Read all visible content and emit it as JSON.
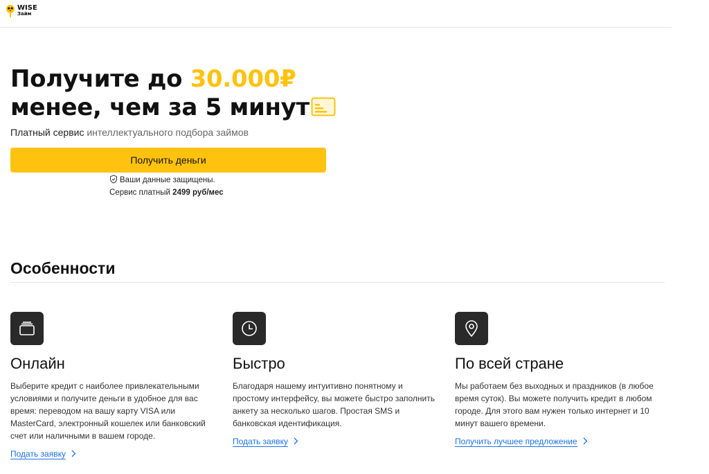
{
  "header": {
    "logo_line1": "WISE",
    "logo_line2": "Займ"
  },
  "hero": {
    "title_prefix": "Получите до ",
    "title_amount": "30.000₽",
    "title_line2": "менее, чем за 5 минут",
    "subtitle_dark": "Платный сервис",
    "subtitle_rest": " интеллектуального подбора займов",
    "cta_label": "Получить деньги",
    "secure_text": "Ваши данные защищены.",
    "price_prefix": "Сервис платный ",
    "price_value": "2499 руб/мес"
  },
  "features": {
    "title": "Особенности",
    "items": [
      {
        "icon": "wallet-icon",
        "title": "Онлайн",
        "desc": "Выберите кредит с наиболее привлекательными условиями и получите деньги в удобное для вас время: переводом на вашу карту VISA или MasterCard, электронный кошелек или банковский счет или наличными в вашем городе.",
        "link": "Подать заявку"
      },
      {
        "icon": "clock-icon",
        "title": "Быстро",
        "desc": "Благодаря нашему интуитивно понятному и простому интерфейсу, вы можете быстро заполнить анкету за несколько шагов. Простая SMS и банковская идентификация.",
        "link": "Подать заявку"
      },
      {
        "icon": "location-pin-icon",
        "title": "По всей стране",
        "desc": "Мы работаем без выходных и праздников (в любое время суток). Вы можете получить кредит в любом городе. Для этого вам нужен только интернет и 10 минут вашего времени.",
        "link": "Получить лучшее предложение"
      }
    ]
  },
  "colors": {
    "accent": "#ffc20e",
    "link": "#1a73e8",
    "icon_bg": "#2a2a2a"
  }
}
